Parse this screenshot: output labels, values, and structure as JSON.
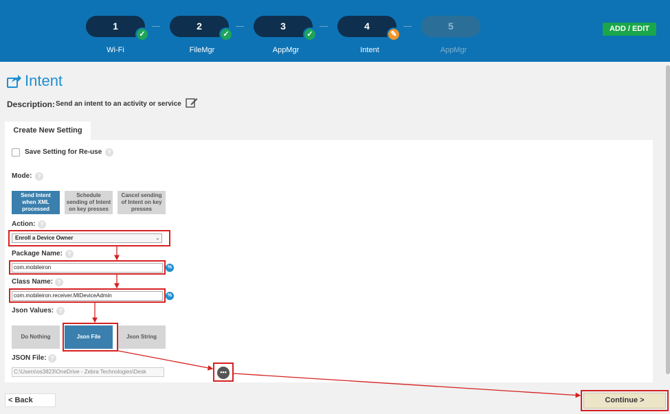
{
  "header": {
    "steps": [
      {
        "number": "1",
        "label": "Wi-Fi",
        "status": "done"
      },
      {
        "number": "2",
        "label": "FileMgr",
        "status": "done"
      },
      {
        "number": "3",
        "label": "AppMgr",
        "status": "done"
      },
      {
        "number": "4",
        "label": "Intent",
        "status": "editing"
      },
      {
        "number": "5",
        "label": "AppMgr",
        "status": "disabled"
      }
    ],
    "add_edit_label": "ADD / EDIT",
    "check_glyph": "✓",
    "edit_glyph": "✎"
  },
  "page": {
    "title": "Intent",
    "title_icon": "share-icon",
    "description_label": "Description:",
    "description_text": "Send an intent to an activity or service"
  },
  "tab": {
    "label": "Create New Setting"
  },
  "form": {
    "save_setting_label": "Save Setting for Re-use",
    "save_setting_checked": false,
    "mode_label": "Mode:",
    "mode_options": [
      "Send Intent when XML processed",
      "Schedule sending of Intent on key presses",
      "Cancel sending of Intent on key presses"
    ],
    "mode_selected": "Send Intent when XML processed",
    "action_label": "Action:",
    "action_value": "Enroll a Device Owner",
    "package_label": "Package Name:",
    "package_value": "com.mobileiron",
    "class_label": "Class Name:",
    "class_value": "com.mobileiron.receiver.MIDeviceAdmin",
    "json_values_label": "Json Values:",
    "json_options": [
      "Do Nothing",
      "Json File",
      "Json String"
    ],
    "json_selected": "Json File",
    "json_file_label": "JSON File:",
    "json_file_value": "C:\\Users\\os3823\\OneDrive - Zebra Technologies\\Desk",
    "browse_glyph": "•••",
    "help_glyph": "?",
    "var_glyph": "%"
  },
  "footer": {
    "back_label": "<  Back",
    "continue_label": "Continue  >"
  },
  "colors": {
    "header_bg": "#0d73b4",
    "step_bg": "#0e2f4d",
    "check_green": "#1ea55b",
    "edit_orange": "#f0962c",
    "add_edit_green": "#1aa64a",
    "accent_blue": "#1e8fd0",
    "selected_button": "#3a7fad",
    "annotation_red": "#d62020",
    "continue_bg": "#ede5c8"
  }
}
